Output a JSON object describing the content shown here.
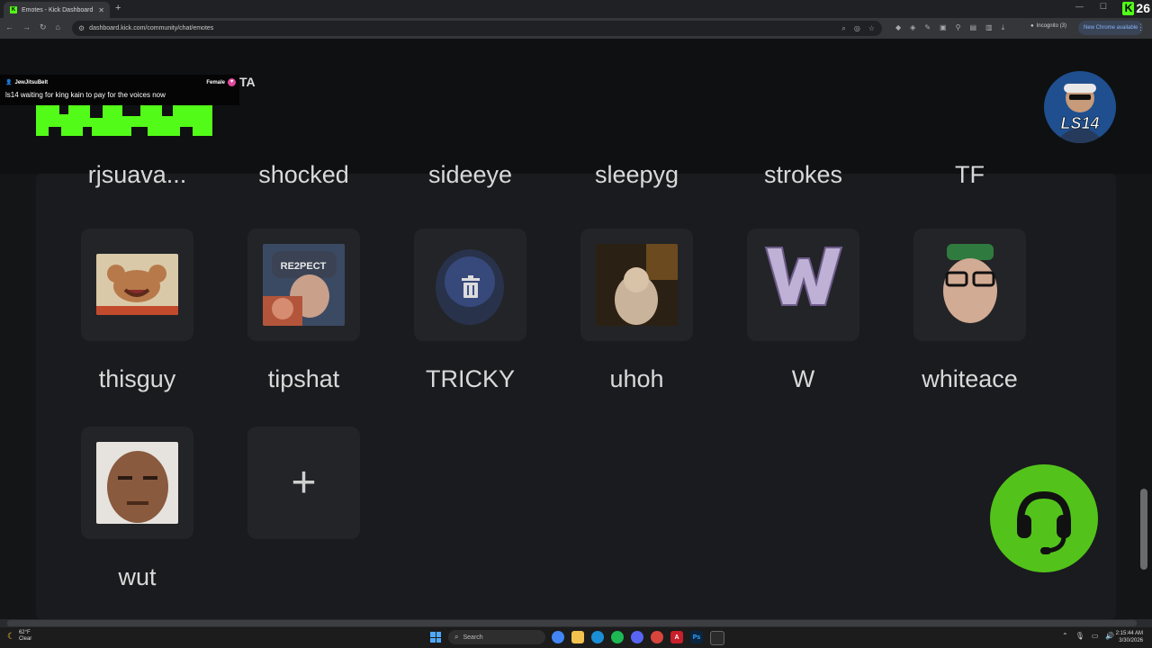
{
  "browser": {
    "tab_title": "Emotes - Kick Dashboard",
    "new_tab_icon": "plus-icon",
    "url": "dashboard.kick.com/community/chat/emotes",
    "incognito_label": "Incognito (3)",
    "new_chrome_label": "New Chrome available",
    "corner_badge": "26"
  },
  "overlay_chat": {
    "username": "JewJitsuBelt",
    "gender_label": "Female",
    "message": "ls14 waiting for king kain to pay for the voices now"
  },
  "header": {
    "partial_text": "TA",
    "brand_color": "#53fc18"
  },
  "avatar": {
    "label": "LS14"
  },
  "emotes_partial_row": [
    "rjsuava...",
    "shocked",
    "sideeye",
    "sleepyg",
    "strokes",
    "TF"
  ],
  "emotes": [
    {
      "name": "thisguy"
    },
    {
      "name": "tipshat"
    },
    {
      "name": "TRICKY"
    },
    {
      "name": "uhoh"
    },
    {
      "name": "W"
    },
    {
      "name": "whiteace"
    },
    {
      "name": "wut"
    }
  ],
  "add_emote_symbol": "+",
  "taskbar": {
    "weather_temp": "62°F",
    "weather_desc": "Clear",
    "search_placeholder": "Search",
    "time": "2:15:44 AM",
    "date": "3/30/2026"
  }
}
